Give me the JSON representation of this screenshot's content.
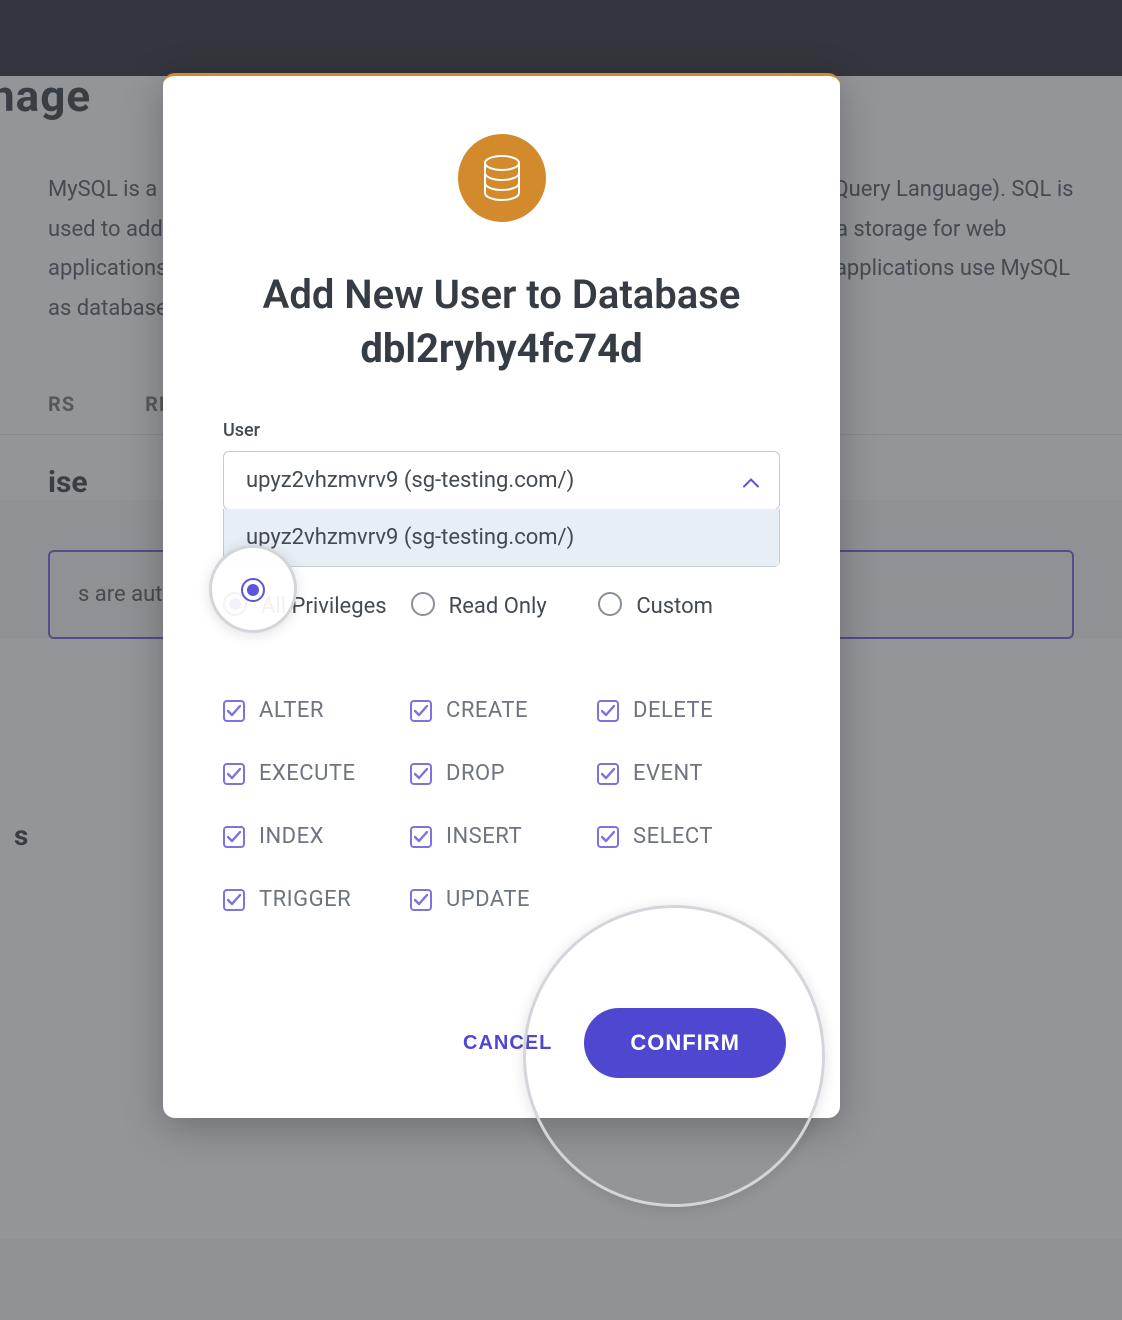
{
  "background": {
    "heading_fragment": "nage",
    "description": "MySQL is a Relational Database Management System that uses SQL (Structured Query Language). SQL is used to add, remove, or modify content in a database. MySQL is the preferred data storage for web applications due to its scalability, flexibility and ease of use — most popular PHP applications use MySQL as database engine.",
    "tabs": {
      "users_fragment": "RS",
      "remote": "REM"
    },
    "create_db_fragment": "ise",
    "notice_fragment": "s are automatica",
    "manage_heading_fragment": "s"
  },
  "modal": {
    "title_prefix": "Add New User to Database",
    "db_name": "dbl2ryhy4fc74d",
    "user_label": "User",
    "user_selected": "upyz2vhzmvrv9 (sg-testing.com/)",
    "user_option": "upyz2vhzmvrv9 (sg-testing.com/)",
    "radios": {
      "all": "All Privileges",
      "read": "Read Only",
      "custom": "Custom"
    },
    "privileges": [
      "ALTER",
      "CREATE",
      "DELETE",
      "EXECUTE",
      "DROP",
      "EVENT",
      "INDEX",
      "INSERT",
      "SELECT",
      "TRIGGER",
      "UPDATE"
    ],
    "actions": {
      "cancel": "CANCEL",
      "confirm": "CONFIRM"
    }
  },
  "icons": {
    "database": "database-icon",
    "chevron_up": "chevron-up-icon",
    "check": "check-icon"
  }
}
